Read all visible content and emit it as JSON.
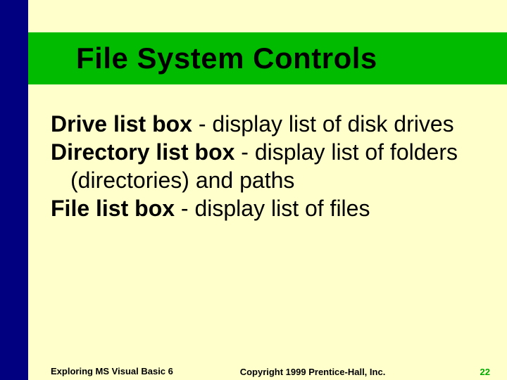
{
  "title": "File System Controls",
  "body": {
    "items": [
      {
        "term": "Drive list box",
        "desc": " - display list of disk drives"
      },
      {
        "term": "Directory list box",
        "desc": " - display list of folders (directories) and paths"
      },
      {
        "term": "File list box",
        "desc": " - display list of files"
      }
    ]
  },
  "footer": {
    "left": "Exploring MS Visual Basic 6",
    "center": "Copyright 1999 Prentice-Hall, Inc.",
    "page": "22"
  }
}
